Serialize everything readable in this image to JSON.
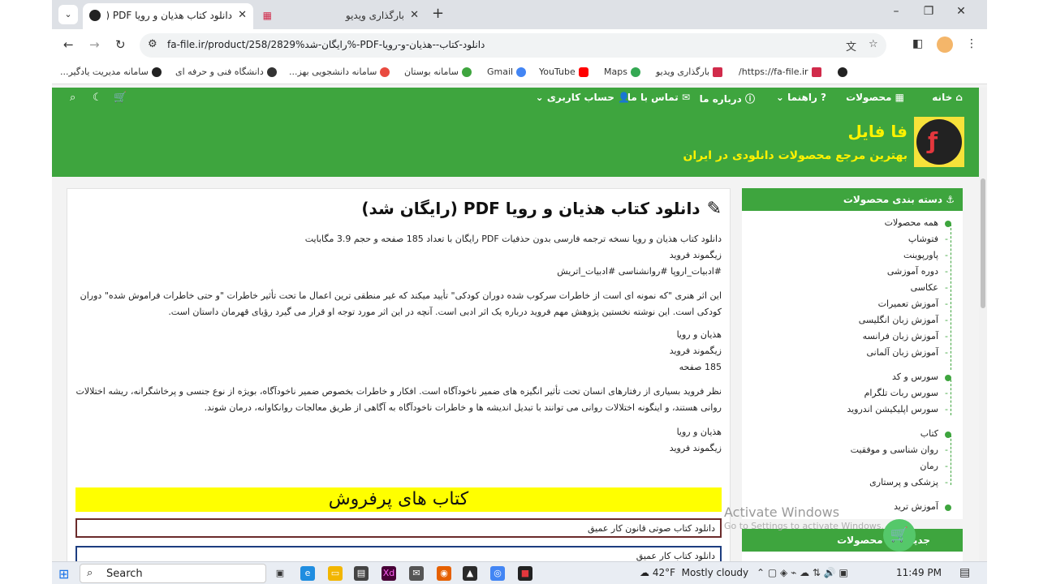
{
  "browser": {
    "tabs": [
      {
        "title": "دانلود کتاب هذیان و رویا PDF (رای",
        "active": true
      },
      {
        "title": "بارگذاری ویدیو",
        "active": false
      }
    ],
    "url": "fa-file.ir/product/258/رایگان-شد%2829%-PDF-دانلود-کتاب--هذیان-و-رویا",
    "bookmarks": [
      "https://fa-file.ir/",
      "بارگذاری ویدیو",
      "Maps",
      "YouTube",
      "Gmail",
      "سامانه بوستان",
      "سامانه دانشجویی بهز...",
      "دانشگاه فنی و حرفه ای",
      "سامانه مدیریت یادگیر..."
    ]
  },
  "site": {
    "nav": {
      "home": "خانه",
      "products": "محصولات",
      "guide": "راهنما",
      "about": "درباره ما",
      "contact": "تماس با ما",
      "account": "حساب کاربری"
    },
    "brand": "فا فایل",
    "tagline": "بهترین مرجع محصولات دانلودی در ایران"
  },
  "article": {
    "title": "دانلود کتاب هذیان و رویا PDF (رایگان شد)",
    "lines": [
      "دانلود کتاب هذیان و رویا نسخه ترجمه فارسی بدون حذفیات PDF رایگان با تعداد 185 صفحه و حجم 3.9 مگابایت",
      "زیگموند فروید",
      "#ادبیات_اروپا #روانشناسی #ادبیات_اتریش"
    ],
    "para1": "این اثر هنری \"که نمونه ای است از خاطرات سرکوب شده دوران کودکی\" تأیید میکند که غیر منطقی ترین اعمال ما تحت تأثیر خاطرات \"و حتی خاطرات فراموش شده\" دوران کودکی است. این نوشته نخستین پژوهش مهم فروید درباره یک اثر ادبی است. آنچه در این اثر مورد توجه او قرار می گیرد رؤیای قهرمان داستان است.",
    "block2": [
      "هذیان و رویا",
      "زیگموند فروید",
      "185 صفحه"
    ],
    "para2": "نظر فروید بسیاری از رفتارهای انسان تحت تأثیر انگیزه های ضمیر ناخودآگاه است. افکار و خاطرات بخصوص ضمیر ناخودآگاه، بویژه از نوع جنسی و پرخاشگرانه، ریشه اختلالات روانی هستند، و اینگونه اختلالات روانی می توانند با تبدیل اندیشه ها و خاطرات ناخودآگاه به آگاهی از طریق معالجات روانکاوانه، درمان شوند.",
    "block3": [
      "هذیان و رویا",
      "زیگموند فروید"
    ],
    "bestseller_title": "کتاب های پرفروش",
    "bestsellers": [
      "دانلود کتاب صوتی قانون کار عمیق",
      "دانلود کتاب کار عمیق"
    ]
  },
  "sidebar": {
    "title": "دسته بندی محصولات",
    "groups": [
      {
        "label": "همه محصولات",
        "items": [
          "فتوشاپ",
          "پاورپوینت",
          "دوره آموزشی",
          "عکاسی",
          "آموزش تعمیرات",
          "آموزش زبان انگلیسی",
          "آموزش زبان فرانسه",
          "آموزش زبان آلمانی"
        ]
      },
      {
        "label": "سورس و کد",
        "items": [
          "سورس ربات تلگرام",
          "سورس اپلیکیشن اندروید"
        ]
      },
      {
        "label": "کتاب",
        "items": [
          "روان شناسی و موفقیت",
          "رمان",
          "پزشکی و پرستاری"
        ]
      },
      {
        "label": "آموزش ترید",
        "items": []
      }
    ],
    "newest_title": "جدیدترین محصولات"
  },
  "watermark": {
    "line1": "Activate Windows",
    "line2": "Go to Settings to activate Windows."
  },
  "taskbar": {
    "search": "Search",
    "weather_temp": "42°F",
    "weather_text": "Mostly cloudy",
    "time": "11:49 PM"
  }
}
